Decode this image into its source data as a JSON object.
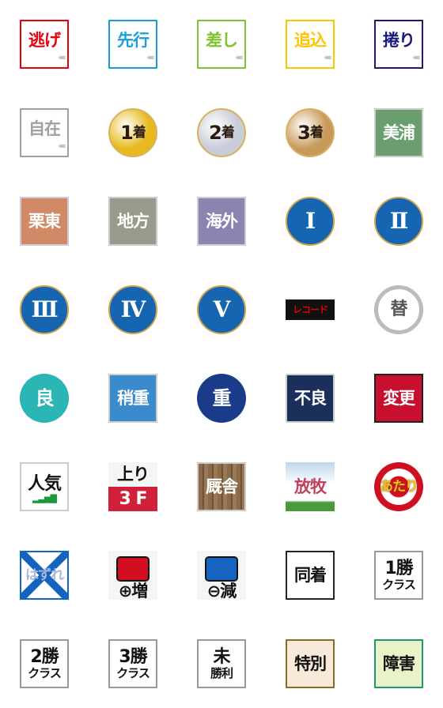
{
  "stickers": [
    {
      "name": "nige",
      "kind": "run",
      "lines": [
        "逃げ"
      ],
      "color": "#e60012"
    },
    {
      "name": "senko",
      "kind": "run",
      "lines": [
        "先行"
      ],
      "color": "#1aa0d8"
    },
    {
      "name": "sashi",
      "kind": "run",
      "lines": [
        "差し"
      ],
      "color": "#7dc52e"
    },
    {
      "name": "oikomi",
      "kind": "run",
      "lines": [
        "追込"
      ],
      "color": "#ffc400"
    },
    {
      "name": "makuri",
      "kind": "run",
      "lines": [
        "捲り"
      ],
      "color": "#1a1a7a"
    },
    {
      "name": "jizai",
      "kind": "run",
      "lines": [
        "自在"
      ],
      "color": "#a0a0a0"
    },
    {
      "name": "1st-place",
      "kind": "medal",
      "lines": [
        "1",
        "着"
      ],
      "color": "#e8b820"
    },
    {
      "name": "2nd-place",
      "kind": "medal",
      "lines": [
        "2",
        "着"
      ],
      "color": "#c8ccd8"
    },
    {
      "name": "3rd-place",
      "kind": "medal",
      "lines": [
        "3",
        "着"
      ],
      "color": "#c89a5a"
    },
    {
      "name": "miho",
      "kind": "fill",
      "lines": [
        "美浦"
      ],
      "color": "#6a9e6e"
    },
    {
      "name": "ritto",
      "kind": "fill",
      "lines": [
        "栗東"
      ],
      "color": "#d08a66"
    },
    {
      "name": "chiho",
      "kind": "fill",
      "lines": [
        "地方"
      ],
      "color": "#9a9a8a"
    },
    {
      "name": "kaigai",
      "kind": "fill",
      "lines": [
        "海外"
      ],
      "color": "#8a84b0"
    },
    {
      "name": "grade-1",
      "kind": "circ",
      "lines": [
        "Ⅰ"
      ],
      "color": "#1565b0"
    },
    {
      "name": "grade-2",
      "kind": "circ",
      "lines": [
        "Ⅱ"
      ],
      "color": "#1565b0"
    },
    {
      "name": "grade-3",
      "kind": "circ",
      "lines": [
        "Ⅲ"
      ],
      "color": "#1565b0"
    },
    {
      "name": "grade-4",
      "kind": "circ",
      "lines": [
        "Ⅳ"
      ],
      "color": "#1565b0"
    },
    {
      "name": "grade-5",
      "kind": "circ",
      "lines": [
        "Ⅴ"
      ],
      "color": "#1565b0"
    },
    {
      "name": "record",
      "kind": "record",
      "lines": [
        "レコード"
      ],
      "color": "#e00000"
    },
    {
      "name": "kae",
      "kind": "swap",
      "lines": [
        "替"
      ],
      "color": "#888888"
    },
    {
      "name": "ryo",
      "kind": "circ2",
      "lines": [
        "良"
      ],
      "color": "#2bb5b5"
    },
    {
      "name": "yayaomo",
      "kind": "fill",
      "lines": [
        "稍重"
      ],
      "color": "#3a8acc"
    },
    {
      "name": "omo",
      "kind": "circ2",
      "lines": [
        "重"
      ],
      "color": "#1a3a8a"
    },
    {
      "name": "furyo",
      "kind": "fill",
      "lines": [
        "不良"
      ],
      "color": "#1a2f5a"
    },
    {
      "name": "henko",
      "kind": "fill",
      "lines": [
        "変更"
      ],
      "color": "#c8102e"
    },
    {
      "name": "ninki",
      "kind": "ninki",
      "lines": [
        "人気"
      ],
      "color": "#1a9a3a"
    },
    {
      "name": "agari-3f",
      "kind": "agari",
      "lines": [
        "上り",
        "3 F"
      ],
      "color": "#d0203a"
    },
    {
      "name": "kyusha",
      "kind": "fill",
      "lines": [
        "厩舎"
      ],
      "color": "#8a6a48"
    },
    {
      "name": "hoboku",
      "kind": "hoboku",
      "lines": [
        "放牧"
      ],
      "color": "#c0405a"
    },
    {
      "name": "atari",
      "kind": "atari",
      "lines": [
        "あたり"
      ],
      "color": "#d01020"
    },
    {
      "name": "hazure",
      "kind": "hazure",
      "lines": [
        "はずれ"
      ],
      "color": "#1565c0"
    },
    {
      "name": "weight-up",
      "kind": "scale",
      "lines": [
        "⊕増"
      ],
      "color": "#d01020"
    },
    {
      "name": "weight-down",
      "kind": "scale",
      "lines": [
        "⊖減"
      ],
      "color": "#1565c0"
    },
    {
      "name": "dochaku",
      "kind": "sq",
      "lines": [
        "同着"
      ],
      "color": "#222222"
    },
    {
      "name": "1-win-class",
      "kind": "cls",
      "lines": [
        "1勝",
        "クラス"
      ],
      "color": "#999999"
    },
    {
      "name": "2-win-class",
      "kind": "cls",
      "lines": [
        "2勝",
        "クラス"
      ],
      "color": "#999999"
    },
    {
      "name": "3-win-class",
      "kind": "cls",
      "lines": [
        "3勝",
        "クラス"
      ],
      "color": "#999999"
    },
    {
      "name": "maiden",
      "kind": "cls",
      "lines": [
        "未",
        "勝利"
      ],
      "color": "#999999"
    },
    {
      "name": "tokubetsu",
      "kind": "tok",
      "lines": [
        "特別"
      ],
      "color": "#8a6a30"
    },
    {
      "name": "shogai",
      "kind": "sho",
      "lines": [
        "障害"
      ],
      "color": "#1a9a7a"
    }
  ]
}
